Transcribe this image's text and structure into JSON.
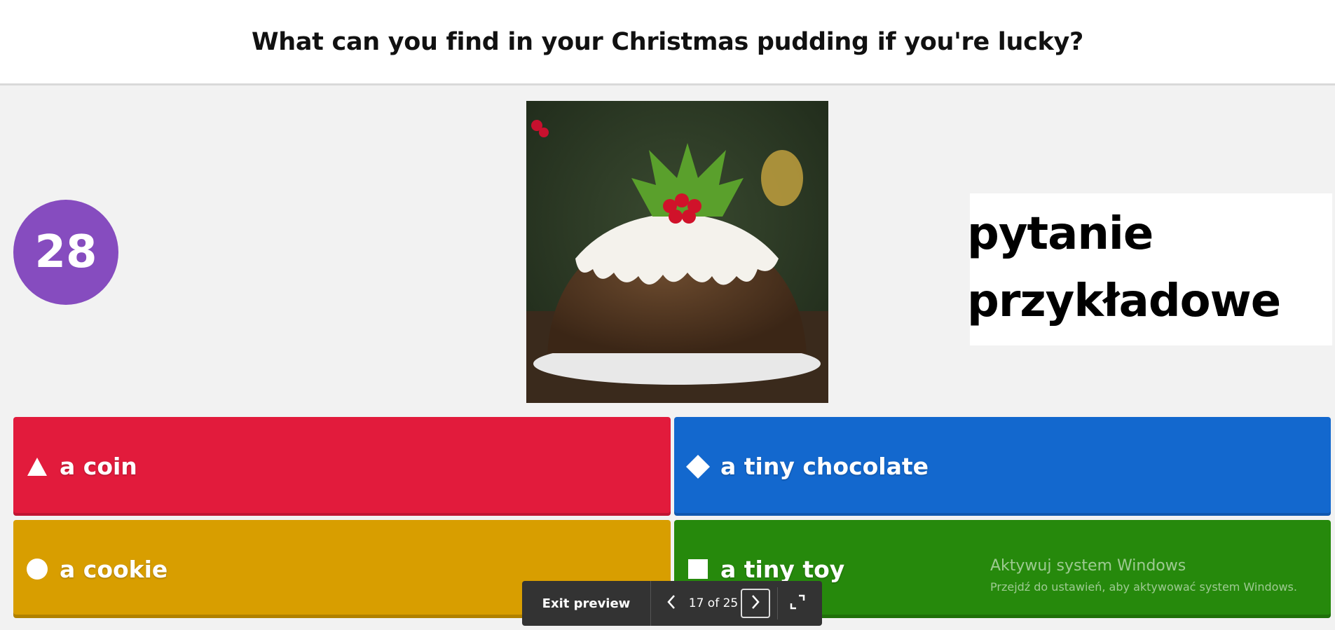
{
  "question": {
    "part1": "What can you find ",
    "part2": "in your Christmas pudding",
    "part3": " if you're lucky?"
  },
  "timer": {
    "value": "28",
    "color": "#864cbf"
  },
  "note": {
    "line1": "pytanie",
    "line2": "przykładowe"
  },
  "answers": [
    {
      "label": "a coin",
      "shape": "triangle-icon",
      "color": "#e21b3c"
    },
    {
      "label": "a tiny chocolate",
      "shape": "diamond-icon",
      "color": "#1368ce"
    },
    {
      "label": "a cookie",
      "shape": "circle-icon",
      "color": "#d89e00"
    },
    {
      "label": "a tiny toy",
      "shape": "square-icon",
      "color": "#26890c"
    }
  ],
  "watermark": {
    "title": "Aktywuj system Windows",
    "subtitle": "Przejdź do ustawień, aby aktywować system Windows."
  },
  "toolbar": {
    "exit_label": "Exit preview",
    "counter": "17 of 25",
    "icons": [
      "chevron-left-icon",
      "chevron-right-icon",
      "fullscreen-icon"
    ]
  }
}
